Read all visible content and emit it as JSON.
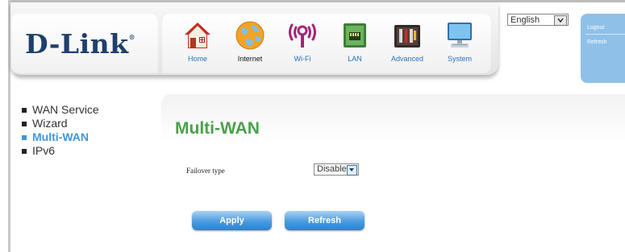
{
  "brand": {
    "logo_text": "D-Link",
    "logo_mark": "®"
  },
  "nav": [
    {
      "label": "Home",
      "icon": "home-icon"
    },
    {
      "label": "Internet",
      "icon": "globe-icon"
    },
    {
      "label": "Wi-Fi",
      "icon": "wifi-icon"
    },
    {
      "label": "LAN",
      "icon": "lan-icon"
    },
    {
      "label": "Advanced",
      "icon": "toolbox-icon"
    },
    {
      "label": "System",
      "icon": "computer-icon"
    }
  ],
  "language": {
    "selected": "English"
  },
  "side_links": {
    "logout": "Logout",
    "refresh": "Refresh"
  },
  "sidebar": {
    "items": [
      {
        "label": "WAN Service"
      },
      {
        "label": "Wizard"
      },
      {
        "label": "Multi-WAN"
      },
      {
        "label": "IPv6"
      }
    ],
    "active_index": 2
  },
  "main": {
    "title": "Multi-WAN",
    "failover_label": "Failover type",
    "failover_value": "Disable",
    "apply_label": "Apply",
    "refresh_label": "Refresh"
  },
  "colors": {
    "title_green": "#4aa14a",
    "active_blue": "#3a98e0",
    "button_blue": "#4a9be0",
    "logo_navy": "#1f3f6b"
  }
}
